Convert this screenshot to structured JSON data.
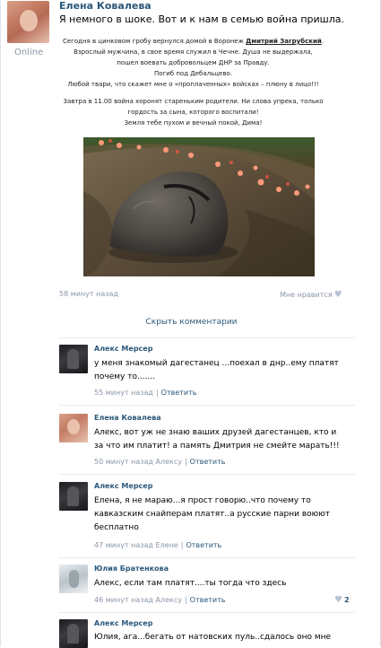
{
  "post": {
    "author": "Елена Ковалева",
    "status": "Online",
    "text": "Я немного в шоке. Вот и к нам в семью война пришла.",
    "article": {
      "l1_pre": "Сегодня в цинковом гробу вернулся домой в Воронеж ",
      "l1_name": "Дмитрий Загрубский",
      "l1_post": ".",
      "l2": "Взрослый мужчина, в свое время служил в Чечне. Душа не выдержала,",
      "l3": "пошел воевать добровольцем ДНР за Правду.",
      "l4": "Погиб под Дебальцево.",
      "l5": "Любой твари, что скажет мне о «проплаченных» войсках – плюну в лицо!!!",
      "l6": "Завтра в 11.00 война хоронят стареньким родители. Ни слова упрека, только",
      "l7": "гордость за сына, которого воспитали!",
      "l8": "Земля тебе пухом и вечный покой, Дима!"
    },
    "time": "58 минут назад",
    "like_label": "Мне нравится",
    "heart_icon": "heart-icon"
  },
  "hide_comments": "Скрыть комментарии",
  "comments": [
    {
      "author": "Алекс Мерсер",
      "lines": [
        "у меня знакомый дагестанец ...поехал в днр..ему платят",
        "почему то......."
      ],
      "time": "55 минут назад",
      "reply": "Ответить"
    },
    {
      "author": "Елена Ковалева",
      "lines": [
        "Алекс, вот уж не знаю ваших друзей дагестанцев, кто и",
        "за что им платит! а память Дмитрия не смейте марать!!!"
      ],
      "time": "50 минут назад Алексу",
      "reply": "Ответить"
    },
    {
      "author": "Алекс Мерсер",
      "lines": [
        "Елена, я не мараю...я прост говорю..что почему то",
        "кавказским снайперам платят..а русские парни воюют",
        "бесплатно"
      ],
      "time": "47 минут назад Елене",
      "reply": "Ответить"
    },
    {
      "author": "Юлия Братенкова",
      "lines": [
        "Алекс, если там платят....ты тогда что здесь"
      ],
      "time": "46 минут назад Алексу",
      "reply": "Ответить",
      "likes": "2"
    },
    {
      "author": "Алекс Мерсер",
      "lines": [
        "Юлия, ага...бегать от натовских пуль..сдалось оно мне"
      ],
      "time": "",
      "reply": ""
    }
  ]
}
